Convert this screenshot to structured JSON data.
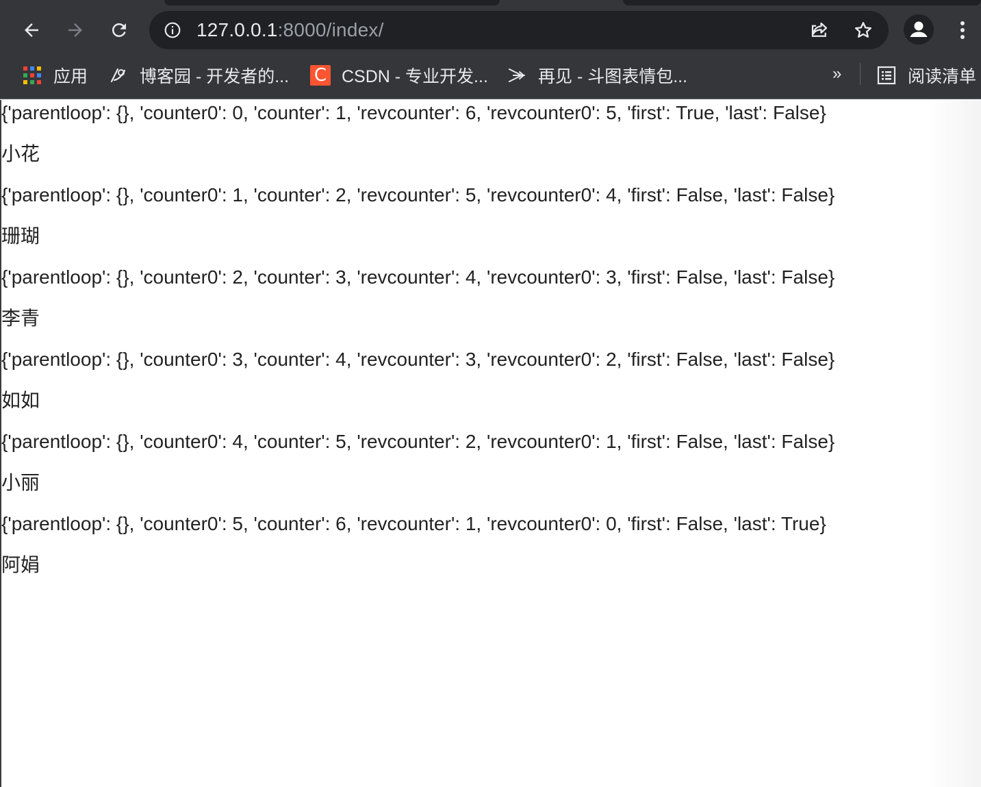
{
  "browser": {
    "url_host": "127.0.0.1",
    "url_path": ":8000/index/",
    "icons": {
      "back": "arrow-left-icon",
      "forward": "arrow-right-icon",
      "reload": "reload-icon",
      "site_info": "info-circle-icon",
      "share": "share-icon",
      "bookmark": "star-icon",
      "profile": "person-icon",
      "menu": "vertical-dots-icon"
    }
  },
  "bookmarks": {
    "items": [
      {
        "label": "应用",
        "icon": "apps-grid-icon"
      },
      {
        "label": "博客园 - 开发者的...",
        "icon": "cnblogs-icon"
      },
      {
        "label": "CSDN - 专业开发...",
        "icon": "csdn-icon",
        "icon_text": "C"
      },
      {
        "label": "再见 - 斗图表情包...",
        "icon": "doutu-icon"
      }
    ],
    "more": "»",
    "reading_list": {
      "label": "阅读清单",
      "icon": "reading-list-icon"
    }
  },
  "content": {
    "lines": [
      "{'parentloop': {}, 'counter0': 0, 'counter': 1, 'revcounter': 6, 'revcounter0': 5, 'first': True, 'last': False}",
      "小花",
      "{'parentloop': {}, 'counter0': 1, 'counter': 2, 'revcounter': 5, 'revcounter0': 4, 'first': False, 'last': False}",
      "珊瑚",
      "{'parentloop': {}, 'counter0': 2, 'counter': 3, 'revcounter': 4, 'revcounter0': 3, 'first': False, 'last': False}",
      "李青",
      "{'parentloop': {}, 'counter0': 3, 'counter': 4, 'revcounter': 3, 'revcounter0': 2, 'first': False, 'last': False}",
      "如如",
      "{'parentloop': {}, 'counter0': 4, 'counter': 5, 'revcounter': 2, 'revcounter0': 1, 'first': False, 'last': False}",
      "小丽",
      "{'parentloop': {}, 'counter0': 5, 'counter': 6, 'revcounter': 1, 'revcounter0': 0, 'first': False, 'last': True}",
      "阿娟"
    ]
  },
  "colors": {
    "chrome_bg": "#35363a",
    "omnibox_bg": "#202124",
    "text_light": "#e8eaed",
    "text_dim": "#9aa0a6",
    "page_text": "#222222",
    "csdn_brand": "#fc5531"
  }
}
